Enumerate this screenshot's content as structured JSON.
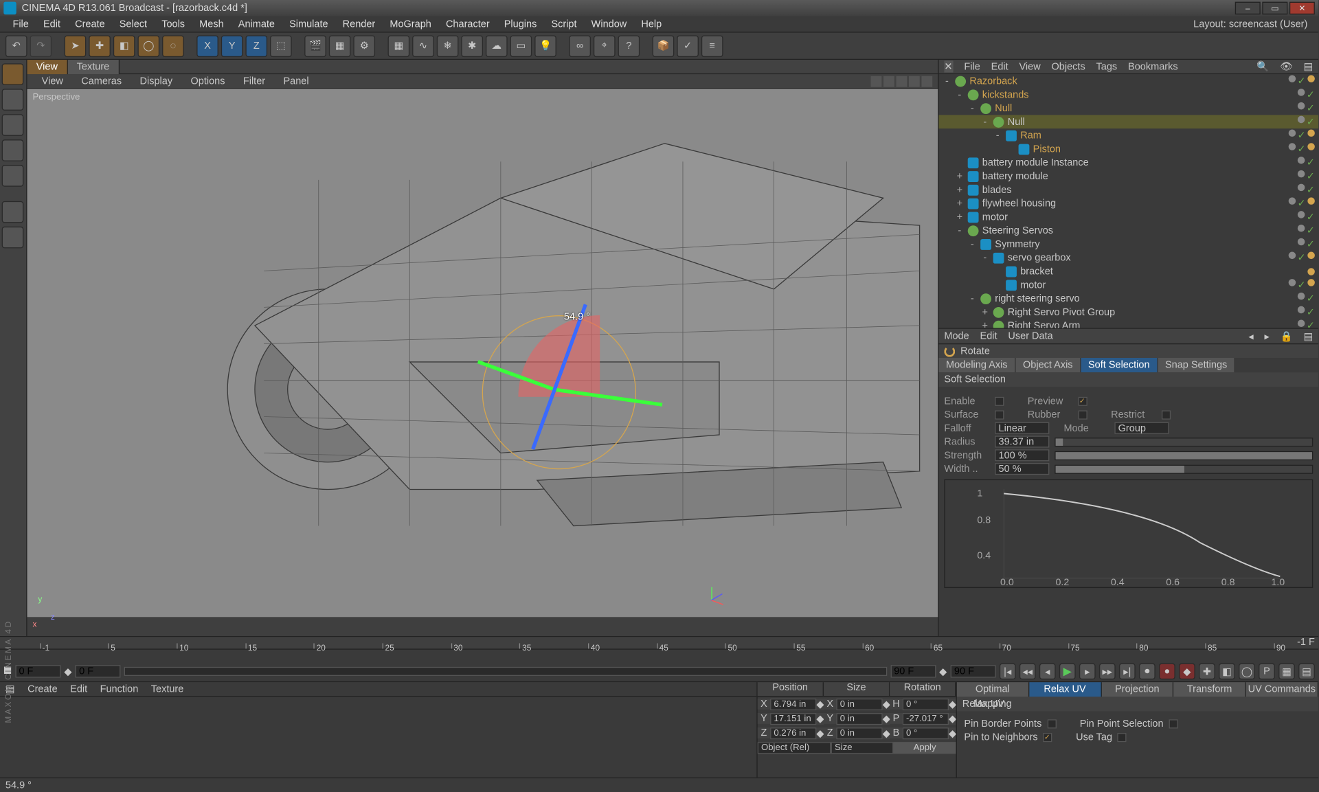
{
  "title": "CINEMA 4D R13.061 Broadcast - [razorback.c4d *]",
  "layout_label": "Layout:",
  "layout_value": "screencast (User)",
  "menu": [
    "File",
    "Edit",
    "Create",
    "Select",
    "Tools",
    "Mesh",
    "Animate",
    "Simulate",
    "Render",
    "MoGraph",
    "Character",
    "Plugins",
    "Script",
    "Window",
    "Help"
  ],
  "view_tabs": [
    "View",
    "Texture"
  ],
  "view_menu": [
    "View",
    "Cameras",
    "Display",
    "Options",
    "Filter",
    "Panel"
  ],
  "viewport_label": "Perspective",
  "rotation_hint": "54.9 °",
  "panel_tabs": [
    "File",
    "Edit",
    "View",
    "Objects",
    "Tags",
    "Bookmarks"
  ],
  "objects": [
    {
      "d": 0,
      "exp": "-",
      "name": "Razorback",
      "hi": true,
      "ic": "null",
      "tags": [
        "dot",
        "chk",
        "tag"
      ]
    },
    {
      "d": 1,
      "exp": "-",
      "name": "kickstands",
      "hi": true,
      "ic": "null",
      "tags": [
        "dot",
        "chk"
      ]
    },
    {
      "d": 2,
      "exp": "-",
      "name": "Null",
      "hi": true,
      "ic": "null",
      "tags": [
        "dot",
        "chk"
      ]
    },
    {
      "d": 3,
      "exp": "-",
      "name": "Null",
      "sel": true,
      "ic": "null",
      "tags": [
        "dot",
        "chk"
      ]
    },
    {
      "d": 4,
      "exp": "-",
      "name": "Ram",
      "hi": true,
      "ic": "obj",
      "tags": [
        "dot",
        "chk",
        "t2"
      ]
    },
    {
      "d": 5,
      "exp": "",
      "name": "Piston",
      "hi": true,
      "ic": "obj",
      "tags": [
        "dot",
        "chk",
        "t2"
      ]
    },
    {
      "d": 1,
      "exp": "",
      "name": "battery module Instance",
      "ic": "obj",
      "tags": [
        "dot",
        "chk"
      ]
    },
    {
      "d": 1,
      "exp": "+",
      "name": "battery module",
      "ic": "obj",
      "tags": [
        "dot",
        "chk"
      ]
    },
    {
      "d": 1,
      "exp": "+",
      "name": "blades",
      "ic": "obj",
      "tags": [
        "dot",
        "chk"
      ]
    },
    {
      "d": 1,
      "exp": "+",
      "name": "flywheel housing",
      "ic": "obj",
      "tags": [
        "dot",
        "chk",
        "t2"
      ]
    },
    {
      "d": 1,
      "exp": "+",
      "name": "motor",
      "ic": "obj",
      "tags": [
        "dot",
        "chk"
      ]
    },
    {
      "d": 1,
      "exp": "-",
      "name": "Steering Servos",
      "ic": "null",
      "tags": [
        "dot",
        "chk"
      ]
    },
    {
      "d": 2,
      "exp": "-",
      "name": "Symmetry",
      "ic": "obj",
      "tags": [
        "dot",
        "chk"
      ]
    },
    {
      "d": 3,
      "exp": "-",
      "name": "servo gearbox",
      "ic": "obj",
      "tags": [
        "dot",
        "chk",
        "t2"
      ]
    },
    {
      "d": 4,
      "exp": "",
      "name": "bracket",
      "ic": "obj",
      "tags": [
        "t3"
      ]
    },
    {
      "d": 4,
      "exp": "",
      "name": "motor",
      "ic": "obj",
      "tags": [
        "dot",
        "chk",
        "t2"
      ]
    },
    {
      "d": 2,
      "exp": "-",
      "name": "right steering servo",
      "ic": "null",
      "tags": [
        "dot",
        "chk"
      ]
    },
    {
      "d": 3,
      "exp": "+",
      "name": "Right Servo Pivot Group",
      "ic": "null",
      "tags": [
        "dot",
        "chk"
      ]
    },
    {
      "d": 3,
      "exp": "+",
      "name": "Right Servo Arm",
      "ic": "null",
      "tags": [
        "dot",
        "chk"
      ]
    }
  ],
  "attr_bar": [
    "Mode",
    "Edit",
    "User Data"
  ],
  "attr_title": "Rotate",
  "attr_tabs": [
    "Modeling Axis",
    "Object Axis",
    "Soft Selection",
    "Snap Settings"
  ],
  "attr_active_tab": 2,
  "soft": {
    "section": "Soft Selection",
    "enable": "Enable",
    "preview": "Preview",
    "surface": "Surface",
    "rubber": "Rubber",
    "restrict": "Restrict",
    "falloff": "Falloff",
    "falloff_val": "Linear",
    "mode": "Mode",
    "mode_val": "Group",
    "radius": "Radius",
    "radius_val": "39.37 in",
    "strength": "Strength",
    "strength_val": "100 %",
    "width": "Width ..",
    "width_val": "50 %"
  },
  "curve_ticks_y": [
    "1",
    "0.8",
    "0.4"
  ],
  "curve_ticks_x": [
    "0.0",
    "0.2",
    "0.4",
    "0.6",
    "0.8",
    "1.0"
  ],
  "timeline": {
    "ticks": [
      "-1",
      "5",
      "10",
      "15",
      "20",
      "25",
      "30",
      "35",
      "40",
      "45",
      "50",
      "55",
      "60",
      "65",
      "70",
      "75",
      "80",
      "85",
      "90"
    ],
    "end_label": "-1 F",
    "f1": "0 F",
    "f2": "0 F",
    "f3": "90 F",
    "f4": "90 F"
  },
  "mat_menu": [
    "Create",
    "Edit",
    "Function",
    "Texture"
  ],
  "coords": {
    "hdr": [
      "Position",
      "Size",
      "Rotation"
    ],
    "rows": [
      {
        "l": "X",
        "p": "6.794 in",
        "s": "0 in",
        "r": "0 °",
        "rl": "H"
      },
      {
        "l": "Y",
        "p": "17.151 in",
        "s": "0 in",
        "r": "-27.017 °",
        "rl": "P"
      },
      {
        "l": "Z",
        "p": "0.276 in",
        "s": "0 in",
        "r": "0 °",
        "rl": "B"
      }
    ],
    "obj_mode": "Object (Rel)",
    "size_mode": "Size",
    "apply": "Apply"
  },
  "uv": {
    "tabs": [
      "Optimal Mapping",
      "Relax UV",
      "Projection",
      "Transform",
      "UV Commands"
    ],
    "active": 1,
    "title": "Relax UV",
    "pin_border": "Pin Border Points",
    "pin_point": "Pin Point Selection",
    "pin_neigh": "Pin to Neighbors",
    "use_tag": "Use Tag"
  },
  "status": "54.9 °"
}
